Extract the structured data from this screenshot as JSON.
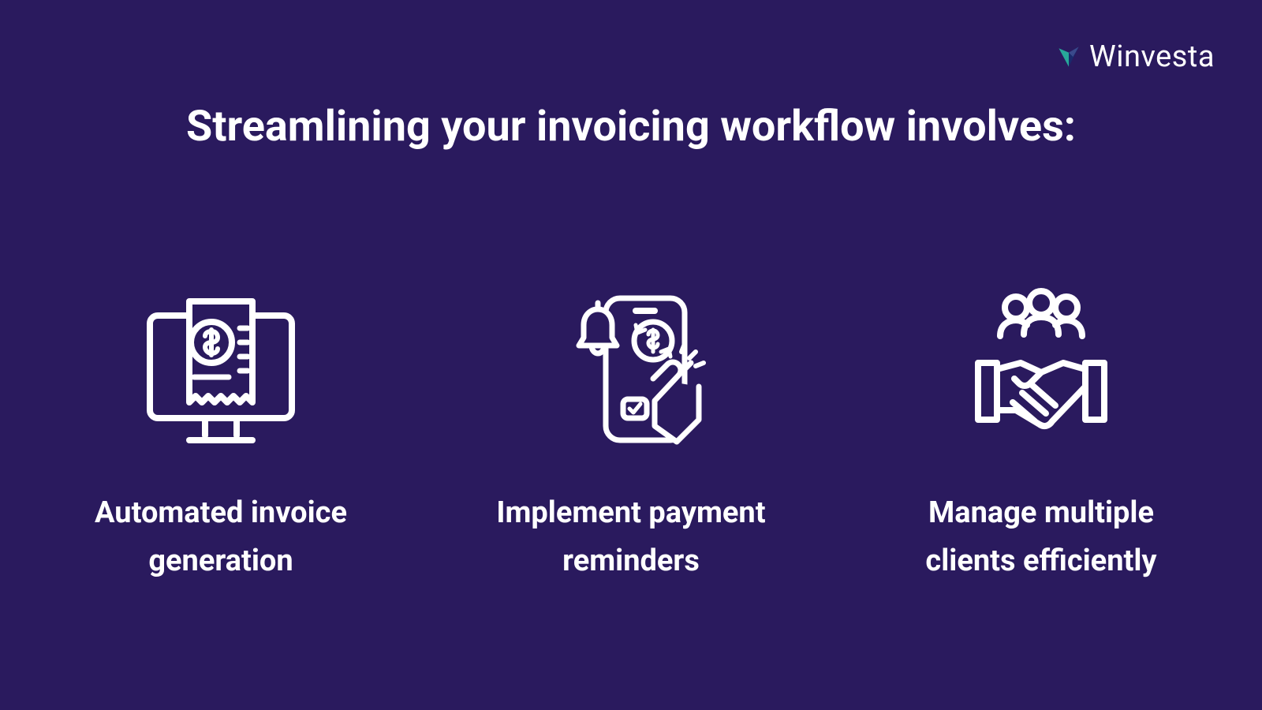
{
  "brand": {
    "name": "Winvesta"
  },
  "title": "Streamlining your invoicing workflow involves:",
  "features": [
    {
      "label": "Automated invoice generation"
    },
    {
      "label": "Implement payment reminders"
    },
    {
      "label": "Manage multiple clients efficiently"
    }
  ]
}
